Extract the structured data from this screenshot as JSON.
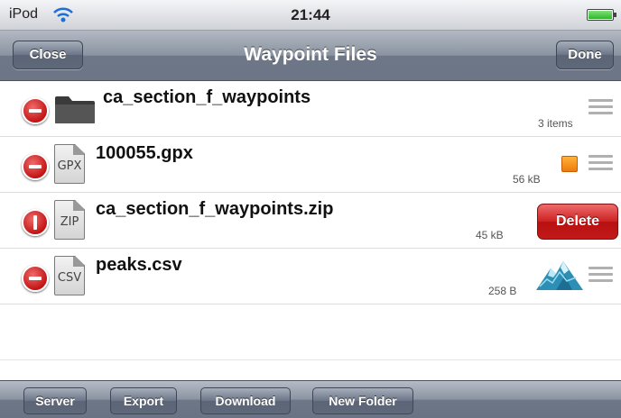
{
  "status_bar": {
    "carrier": "iPod",
    "time": "21:44"
  },
  "nav": {
    "title": "Waypoint Files",
    "close_label": "Close",
    "done_label": "Done"
  },
  "files": [
    {
      "name": "ca_section_f_waypoints",
      "kind": "folder",
      "meta": "3 items",
      "icon": "folder-icon"
    },
    {
      "name": "100055.gpx",
      "kind": "file",
      "ext": "GPX",
      "meta": "56 kB",
      "marker": "orange-square",
      "marker_color": "#f08a1a"
    },
    {
      "name": "ca_section_f_waypoints.zip",
      "kind": "file",
      "ext": "ZIP",
      "meta": "45 kB",
      "delete_label": "Delete",
      "delete_confirm": true
    },
    {
      "name": "peaks.csv",
      "kind": "file",
      "ext": "CSV",
      "meta": "258 B",
      "marker": "mountain-icon"
    }
  ],
  "toolbar": {
    "server_label": "Server",
    "export_label": "Export",
    "download_label": "Download",
    "new_folder_label": "New Folder"
  },
  "colors": {
    "delete_red": "#c71f1f",
    "nav_gray": "#7d8695"
  }
}
